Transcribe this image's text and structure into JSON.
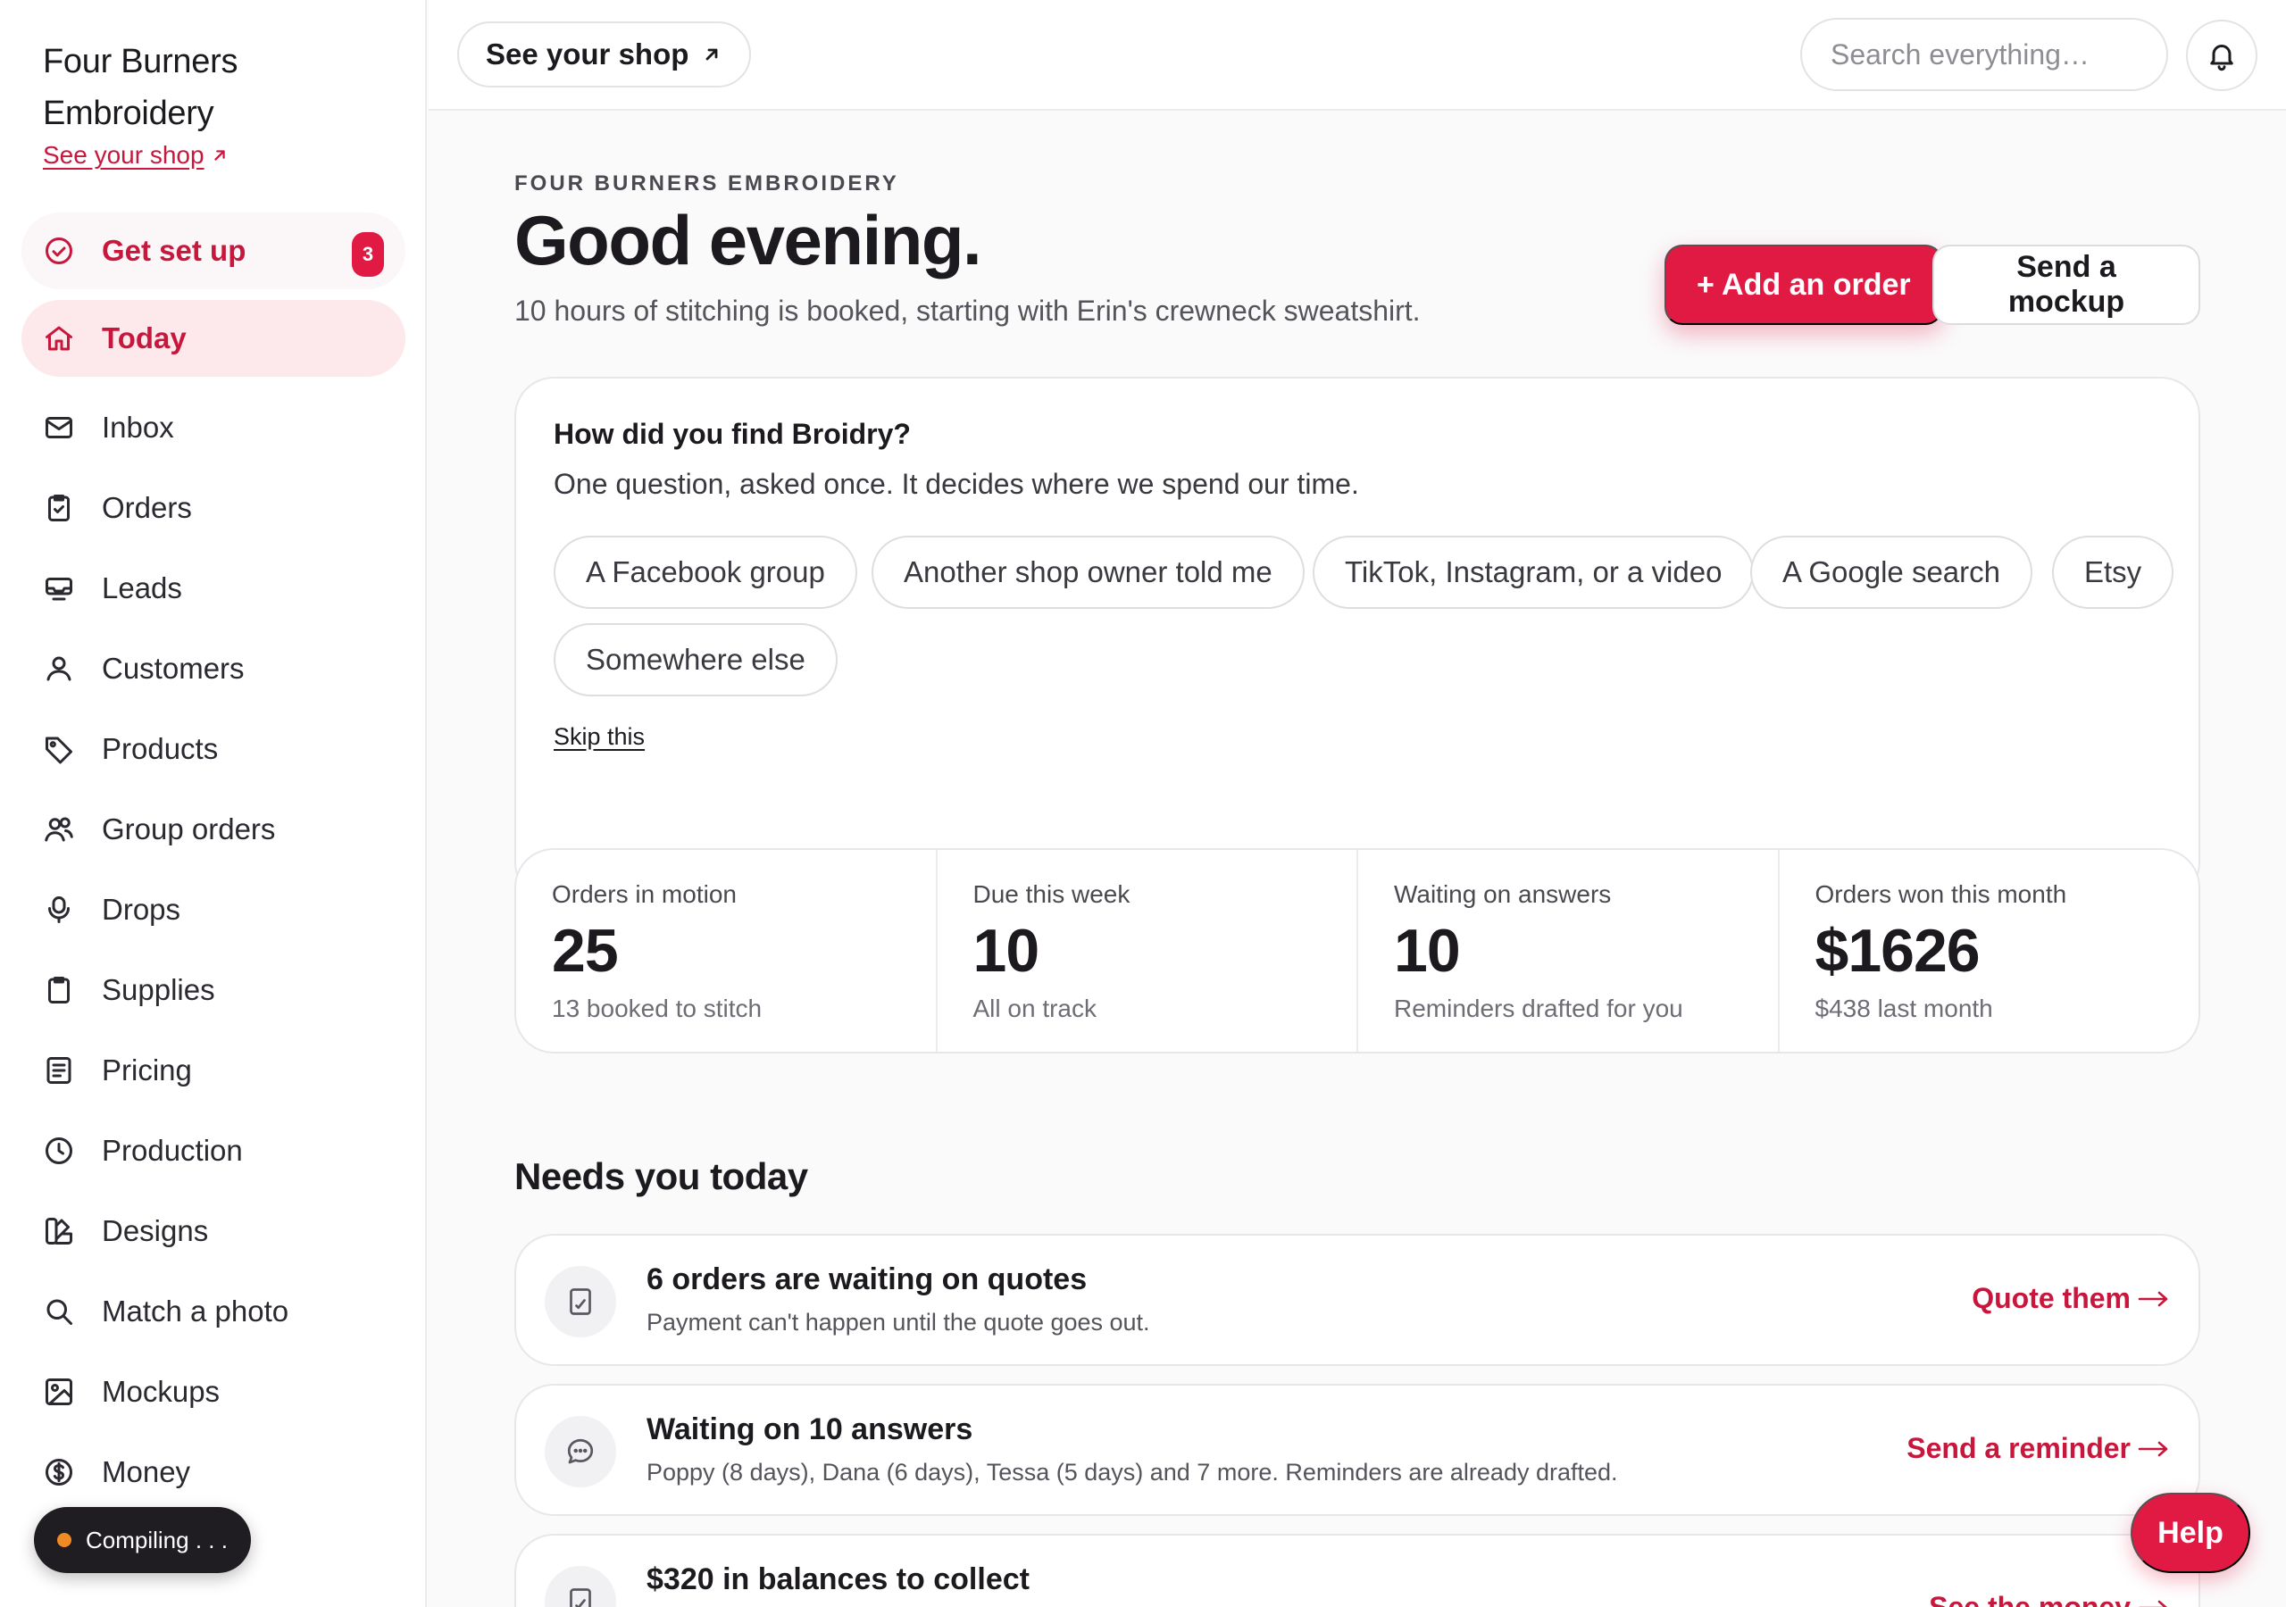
{
  "brand": {
    "name_line1": "Four Burners",
    "name_line2": "Embroidery",
    "shop_link": "See your shop"
  },
  "sidebar": {
    "setup": {
      "label": "Get set up",
      "badge": "3",
      "icon": "check-circle-icon"
    },
    "items": [
      {
        "label": "Today",
        "icon": "home-icon",
        "active": true
      },
      {
        "label": "Inbox",
        "icon": "mail-icon"
      },
      {
        "label": "Orders",
        "icon": "clipboard-check-icon"
      },
      {
        "label": "Leads",
        "icon": "inbox-tray-icon"
      },
      {
        "label": "Customers",
        "icon": "user-icon"
      },
      {
        "label": "Products",
        "icon": "tag-icon"
      },
      {
        "label": "Group orders",
        "icon": "users-icon"
      },
      {
        "label": "Drops",
        "icon": "microphone-icon"
      },
      {
        "label": "Supplies",
        "icon": "clipboard-icon"
      },
      {
        "label": "Pricing",
        "icon": "document-icon"
      },
      {
        "label": "Production",
        "icon": "clock-icon"
      },
      {
        "label": "Designs",
        "icon": "swatch-icon"
      },
      {
        "label": "Match a photo",
        "icon": "search-icon"
      },
      {
        "label": "Mockups",
        "icon": "image-icon"
      },
      {
        "label": "Money",
        "icon": "dollar-circle-icon"
      }
    ],
    "compile_toast": "Compiling . . ."
  },
  "topbar": {
    "see_shop": "See your shop",
    "search_placeholder": "Search everything…"
  },
  "header": {
    "eyebrow": "FOUR BURNERS EMBROIDERY",
    "greeting": "Good evening.",
    "subline": "10 hours of stitching is booked, starting with Erin's crewneck sweatshirt.",
    "primary_action": "+ Add an order",
    "secondary_action": "Send a mockup"
  },
  "survey": {
    "title": "How did you find Broidry?",
    "subtitle": "One question, asked once. It decides where we spend our time.",
    "options": [
      "A Facebook group",
      "Another shop owner told me",
      "TikTok, Instagram, or a video",
      "A Google search",
      "Etsy",
      "Somewhere else"
    ],
    "skip": "Skip this"
  },
  "stats": [
    {
      "label": "Orders in motion",
      "value": "25",
      "note": "13 booked to stitch"
    },
    {
      "label": "Due this week",
      "value": "10",
      "note": "All on track"
    },
    {
      "label": "Waiting on answers",
      "value": "10",
      "note": "Reminders drafted for you"
    },
    {
      "label": "Orders won this month",
      "value": "$1626",
      "note": "$438 last month"
    }
  ],
  "needs": {
    "title": "Needs you today",
    "tasks": [
      {
        "title": "6 orders are waiting on quotes",
        "desc": "Payment can't happen until the quote goes out.",
        "action": "Quote them",
        "icon": "document-check-icon"
      },
      {
        "title": "Waiting on 10 answers",
        "desc": "Poppy (8 days), Dana (6 days), Tessa (5 days) and 7 more. Reminders are already drafted.",
        "action": "Send a reminder",
        "icon": "chat-bubble-icon"
      },
      {
        "title": "$320 in balances to collect",
        "desc": "",
        "action": "See the money",
        "icon": "document-check-icon"
      }
    ]
  },
  "help": "Help",
  "colors": {
    "accent": "#e01a43",
    "accent_text": "#c8173c",
    "active_bg": "#fde9ec"
  }
}
